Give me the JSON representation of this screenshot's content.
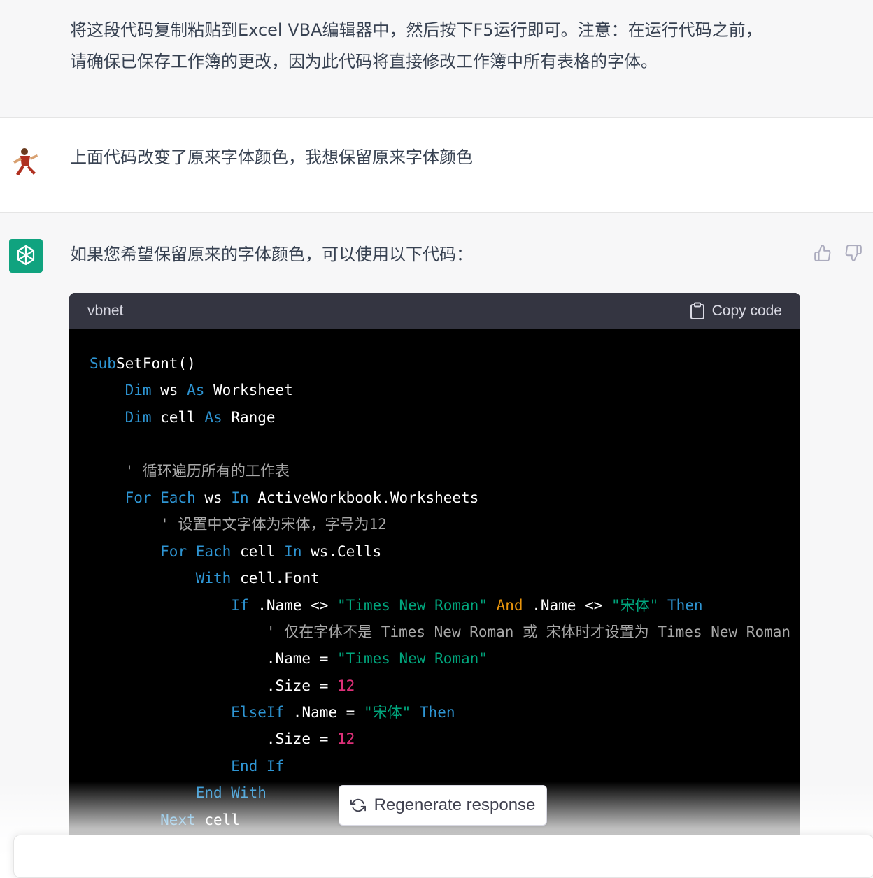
{
  "conversation": {
    "prev_assistant": {
      "text": "将这段代码复制粘贴到Excel VBA编辑器中，然后按下F5运行即可。注意：在运行代码之前，\n请确保已保存工作簿的更改，因为此代码将直接修改工作簿中所有表格的字体。"
    },
    "user": {
      "text": "上面代码改变了原来字体颜色，我想保留原来字体颜色"
    },
    "assistant": {
      "intro": "如果您希望保留原来的字体颜色，可以使用以下代码：",
      "code": {
        "language": "vbnet",
        "copy_label": "Copy code"
      }
    }
  },
  "actions": {
    "thumbs_up": "thumbs-up-icon",
    "thumbs_down": "thumbs-down-icon",
    "regenerate_label": "Regenerate response"
  },
  "colors": {
    "accent": "#10a37f",
    "code_keyword": "#2e95d3",
    "code_string": "#00a67d",
    "code_number": "#df3079",
    "code_comment": "#a8a8a8",
    "code_operator_and": "#e9950c"
  },
  "code_lines": [
    [
      [
        "kw",
        "Sub"
      ],
      [
        "",
        "SetFont()"
      ]
    ],
    [
      [
        "",
        "    "
      ],
      [
        "kw",
        "Dim"
      ],
      [
        "",
        " ws "
      ],
      [
        "kw",
        "As"
      ],
      [
        "",
        " Worksheet"
      ]
    ],
    [
      [
        "",
        "    "
      ],
      [
        "kw",
        "Dim"
      ],
      [
        "",
        " cell "
      ],
      [
        "kw",
        "As"
      ],
      [
        "",
        " Range"
      ]
    ],
    [
      [
        "",
        ""
      ]
    ],
    [
      [
        "",
        "    "
      ],
      [
        "cmt",
        "' 循环遍历所有的工作表"
      ]
    ],
    [
      [
        "",
        "    "
      ],
      [
        "kw",
        "For Each"
      ],
      [
        "",
        " ws "
      ],
      [
        "kw",
        "In"
      ],
      [
        "",
        " ActiveWorkbook.Worksheets"
      ]
    ],
    [
      [
        "",
        "        "
      ],
      [
        "cmt",
        "' 设置中文字体为宋体，字号为12"
      ]
    ],
    [
      [
        "",
        "        "
      ],
      [
        "kw",
        "For Each"
      ],
      [
        "",
        " cell "
      ],
      [
        "kw",
        "In"
      ],
      [
        "",
        " ws.Cells"
      ]
    ],
    [
      [
        "",
        "            "
      ],
      [
        "kw",
        "With"
      ],
      [
        "",
        " cell.Font"
      ]
    ],
    [
      [
        "",
        "                "
      ],
      [
        "kw",
        "If"
      ],
      [
        "",
        " .Name <> "
      ],
      [
        "str",
        "\"Times New Roman\""
      ],
      [
        "",
        " "
      ],
      [
        "and",
        "And"
      ],
      [
        "",
        " .Name <> "
      ],
      [
        "str",
        "\"宋体\""
      ],
      [
        "",
        " "
      ],
      [
        "kw",
        "Then"
      ]
    ],
    [
      [
        "",
        "                    "
      ],
      [
        "cmt",
        "' 仅在字体不是 Times New Roman 或 宋体时才设置为 Times New Roman"
      ]
    ],
    [
      [
        "",
        "                    .Name = "
      ],
      [
        "str",
        "\"Times New Roman\""
      ]
    ],
    [
      [
        "",
        "                    .Size = "
      ],
      [
        "num",
        "12"
      ]
    ],
    [
      [
        "",
        "                "
      ],
      [
        "kw",
        "ElseIf"
      ],
      [
        "",
        " .Name = "
      ],
      [
        "str",
        "\"宋体\""
      ],
      [
        "",
        " "
      ],
      [
        "kw",
        "Then"
      ]
    ],
    [
      [
        "",
        "                    .Size = "
      ],
      [
        "num",
        "12"
      ]
    ],
    [
      [
        "",
        "                "
      ],
      [
        "kw",
        "End If"
      ]
    ],
    [
      [
        "",
        "            "
      ],
      [
        "kw",
        "End With"
      ]
    ],
    [
      [
        "",
        "        "
      ],
      [
        "kw",
        "Next"
      ],
      [
        "",
        " cell"
      ]
    ]
  ]
}
